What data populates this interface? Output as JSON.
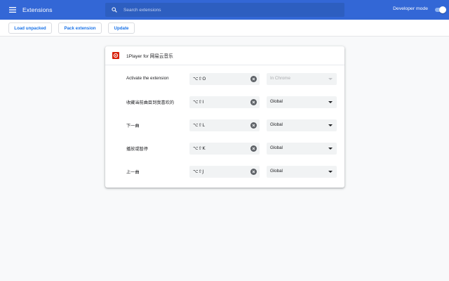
{
  "header": {
    "title": "Extensions",
    "search_placeholder": "Search extensions",
    "developer_mode_label": "Developer mode",
    "developer_mode_on": true,
    "accent_color": "#3367d6"
  },
  "toolbar": {
    "load_unpacked": "Load unpacked",
    "pack_extension": "Pack extension",
    "update": "Update"
  },
  "extension": {
    "name": "1Player for 网易云音乐",
    "icon": "netease-music-icon",
    "icon_color": "#d81e06",
    "shortcuts": [
      {
        "label": "Activate the extension",
        "keys": "⌥⇧O",
        "scope": "In Chrome",
        "scope_disabled": true
      },
      {
        "label": "收藏当前曲目到我喜欢的",
        "keys": "⌥⇧I",
        "scope": "Global",
        "scope_disabled": false
      },
      {
        "label": "下一曲",
        "keys": "⌥⇧L",
        "scope": "Global",
        "scope_disabled": false
      },
      {
        "label": "播放或暂停",
        "keys": "⌥⇧K",
        "scope": "Global",
        "scope_disabled": false
      },
      {
        "label": "上一曲",
        "keys": "⌥⇧J",
        "scope": "Global",
        "scope_disabled": false
      }
    ]
  }
}
